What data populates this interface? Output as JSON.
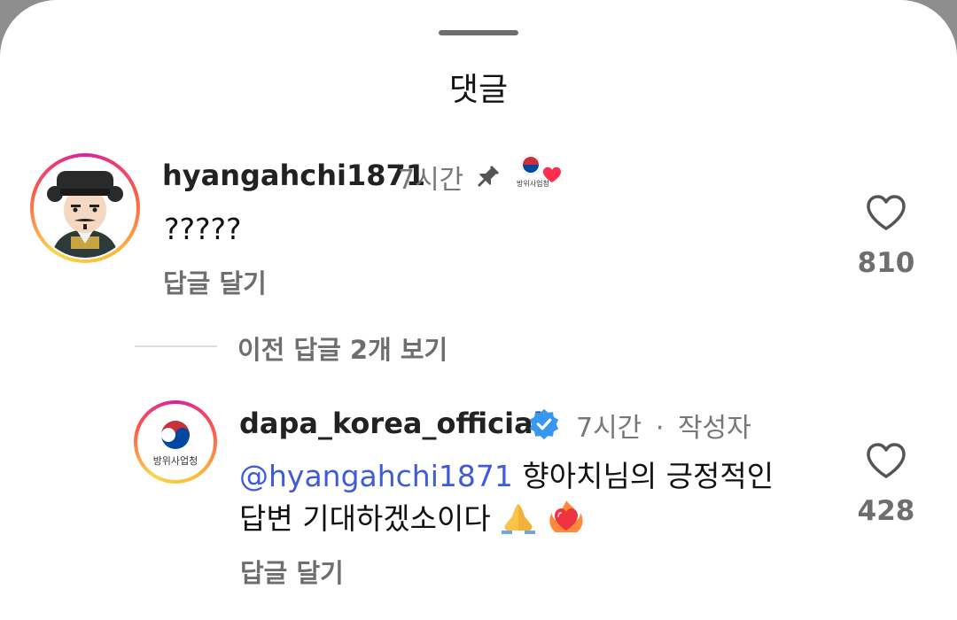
{
  "sheet": {
    "title": "댓글"
  },
  "comments": [
    {
      "username": "hyangahchi1871",
      "time": "7시간",
      "text": "?????",
      "reply_label": "답글 달기",
      "likes": "810",
      "creator_liked_badge": "방위사업청",
      "pinned": true
    }
  ],
  "view_replies_label": "이전 답글 2개 보기",
  "reply": {
    "username": "dapa_korea_official",
    "verified": true,
    "time": "7시간",
    "separator": "·",
    "author_tag": "작성자",
    "mention": "@hyangahchi1871",
    "text_line1": " 향아치님의 긍정적인",
    "text_line2": "답변 기대하겠소이다",
    "reply_label": "답글 달기",
    "likes": "428",
    "avatar_text": "방위사업청"
  },
  "colors": {
    "mention": "#3f5bd8",
    "verified": "#3897f0",
    "heart_badge": "#ff2d4d"
  }
}
